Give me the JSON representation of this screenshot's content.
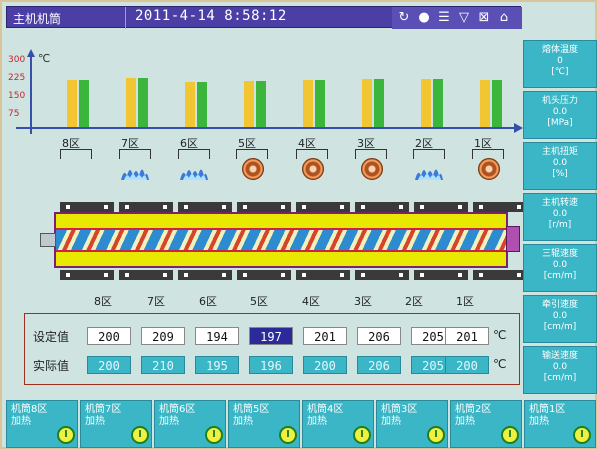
{
  "header": {
    "title": "主机机筒",
    "datetime": "2011-4-14  8:58:12",
    "icons": [
      "refresh-icon",
      "record-icon",
      "list-icon",
      "filter-icon",
      "conveyor-icon",
      "factory-icon",
      "truck-icon"
    ]
  },
  "chart": {
    "y_unit": "℃",
    "y_ticks": [
      "300",
      "225",
      "150",
      "75"
    ]
  },
  "chart_data": {
    "type": "bar",
    "categories": [
      "8区",
      "7区",
      "6区",
      "5区",
      "4区",
      "3区",
      "2区",
      "1区"
    ],
    "series": [
      {
        "values": [
          200,
          209,
          194,
          197,
          201,
          206,
          205,
          201
        ]
      },
      {
        "values": [
          200,
          210,
          195,
          196,
          200,
          206,
          205,
          200
        ]
      }
    ],
    "ylim": [
      0,
      300
    ],
    "colors": [
      "#f2c533",
      "#3cb53c"
    ]
  },
  "zones_top": [
    "8区",
    "7区",
    "6区",
    "5区",
    "4区",
    "3区",
    "2区",
    "1区"
  ],
  "zone_devices": [
    "none",
    "heater-icon",
    "heater-icon",
    "fan-icon",
    "fan-icon",
    "fan-icon",
    "heater-icon",
    "fan-icon"
  ],
  "zones_bottom": [
    "8区",
    "7区",
    "6区",
    "5区",
    "4区",
    "3区",
    "2区",
    "1区"
  ],
  "table": {
    "set_label": "设定值",
    "actual_label": "实际值",
    "unit": "℃",
    "set_values": [
      "200",
      "209",
      "194",
      "197",
      "201",
      "206",
      "205",
      "201"
    ],
    "actual_values": [
      "200",
      "210",
      "195",
      "196",
      "200",
      "206",
      "205",
      "200"
    ],
    "selected_index": 3
  },
  "sidebar": [
    {
      "label": "熔体温度",
      "value": "0",
      "unit": "[℃]"
    },
    {
      "label": "机头压力",
      "value": "0.0",
      "unit": "[MPa]"
    },
    {
      "label": "主机扭矩",
      "value": "0.0",
      "unit": "[%]"
    },
    {
      "label": "主机转速",
      "value": "0.0",
      "unit": "[r/m]"
    },
    {
      "label": "三辊速度",
      "value": "0.0",
      "unit": "[cm/m]"
    },
    {
      "label": "牵引速度",
      "value": "0.0",
      "unit": "[cm/m]"
    },
    {
      "label": "输送速度",
      "value": "0.0",
      "unit": "[cm/m]"
    }
  ],
  "bottom_buttons": [
    {
      "line1": "机筒8区",
      "line2": "加热"
    },
    {
      "line1": "机筒7区",
      "line2": "加热"
    },
    {
      "line1": "机筒6区",
      "line2": "加热"
    },
    {
      "line1": "机筒5区",
      "line2": "加热"
    },
    {
      "line1": "机筒4区",
      "line2": "加热"
    },
    {
      "line1": "机筒3区",
      "line2": "加热"
    },
    {
      "line1": "机筒2区",
      "line2": "加热"
    },
    {
      "line1": "机筒1区",
      "line2": "加热"
    }
  ]
}
